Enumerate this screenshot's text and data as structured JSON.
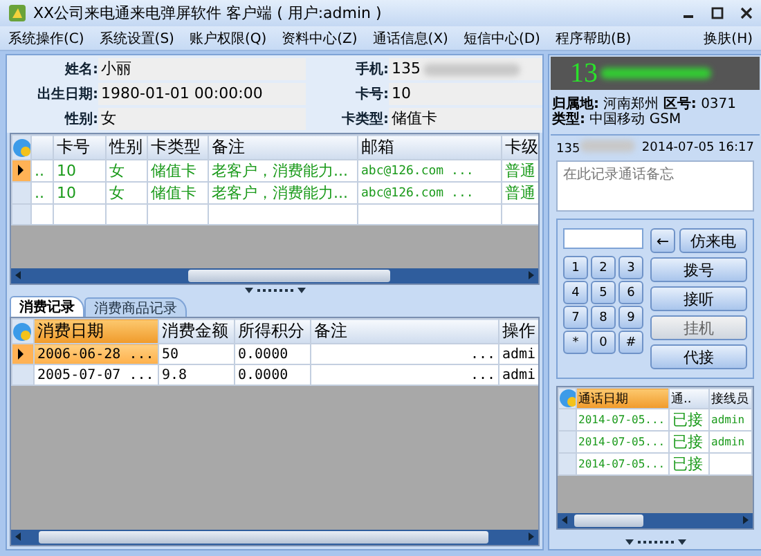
{
  "window": {
    "title": "XX公司来电通来电弹屏软件 客户端 ( 用户:admin )"
  },
  "menu": {
    "items": [
      "系统操作(C)",
      "系统设置(S)",
      "账户权限(Q)",
      "资料中心(Z)",
      "通话信息(X)",
      "短信中心(D)",
      "程序帮助(B)"
    ],
    "skin": "换肤(H)"
  },
  "customer": {
    "fields": [
      {
        "label": "姓名:",
        "value": "小丽"
      },
      {
        "label": "手机:",
        "value": "135"
      },
      {
        "label": "出生日期:",
        "value": "1980-01-01 00:00:00"
      },
      {
        "label": "卡号:",
        "value": "10"
      },
      {
        "label": "性别:",
        "value": "女"
      },
      {
        "label": "卡类型:",
        "value": "储值卡"
      }
    ]
  },
  "customer_grid": {
    "columns": [
      "卡号",
      "性别",
      "卡类型",
      "备注",
      "邮箱",
      "卡级"
    ],
    "rows": [
      {
        "selected": true,
        "column_1": "..",
        "cells": [
          "10",
          "女",
          "储值卡",
          "老客户，消费能力...",
          "abc@126.com   ...",
          "普通"
        ]
      },
      {
        "selected": false,
        "column_1": "..",
        "cells": [
          "10",
          "女",
          "储值卡",
          "老客户，消费能力...",
          "abc@126.com   ...",
          "普通"
        ]
      }
    ]
  },
  "tabs": [
    {
      "label": "消费记录",
      "selected": true
    },
    {
      "label": "消费商品记录",
      "selected": false
    }
  ],
  "purchase_grid": {
    "columns": [
      {
        "label": "消费日期",
        "highlighted": true
      },
      {
        "label": "消费金额",
        "highlighted": false
      },
      {
        "label": "所得积分",
        "highlighted": false
      },
      {
        "label": "备注",
        "highlighted": false
      },
      {
        "label": "操作",
        "highlighted": false
      }
    ],
    "rows": [
      {
        "selected": true,
        "cells": [
          "2006-06-28 ...",
          "50",
          "0.0000",
          "...",
          "admi"
        ]
      },
      {
        "selected": false,
        "cells": [
          "2005-07-07 ...",
          "9.8",
          "0.0000",
          "...",
          "admi"
        ]
      }
    ]
  },
  "caller": {
    "number": "13",
    "location_label": "归属地:",
    "location": "河南郑州",
    "area_label": "区号:",
    "area": "0371",
    "type_label": "类型:",
    "type": "中国移动 GSM"
  },
  "call_note": {
    "number": "135",
    "time": "2014-07-05 16:17",
    "placeholder": "在此记录通话备忘"
  },
  "dialpad": {
    "back": "←",
    "simulate": "仿来电",
    "keys": [
      "1",
      "2",
      "3",
      "4",
      "5",
      "6",
      "7",
      "8",
      "9",
      "*",
      "0",
      "#"
    ],
    "actions": [
      {
        "label": "拨号",
        "disabled": false
      },
      {
        "label": "接听",
        "disabled": false
      },
      {
        "label": "挂机",
        "disabled": true
      },
      {
        "label": "代接",
        "disabled": false
      }
    ]
  },
  "call_grid": {
    "columns": [
      {
        "label": "通话日期",
        "highlighted": true
      },
      {
        "label": "通..",
        "highlighted": false
      },
      {
        "label": "接线员",
        "highlighted": false
      }
    ],
    "rows": [
      {
        "cells": [
          "2014-07-05...",
          "已接",
          "admin"
        ]
      },
      {
        "cells": [
          "2014-07-05...",
          "已接",
          "admin"
        ]
      },
      {
        "cells": [
          "2014-07-05...",
          "已接",
          null
        ]
      }
    ]
  }
}
